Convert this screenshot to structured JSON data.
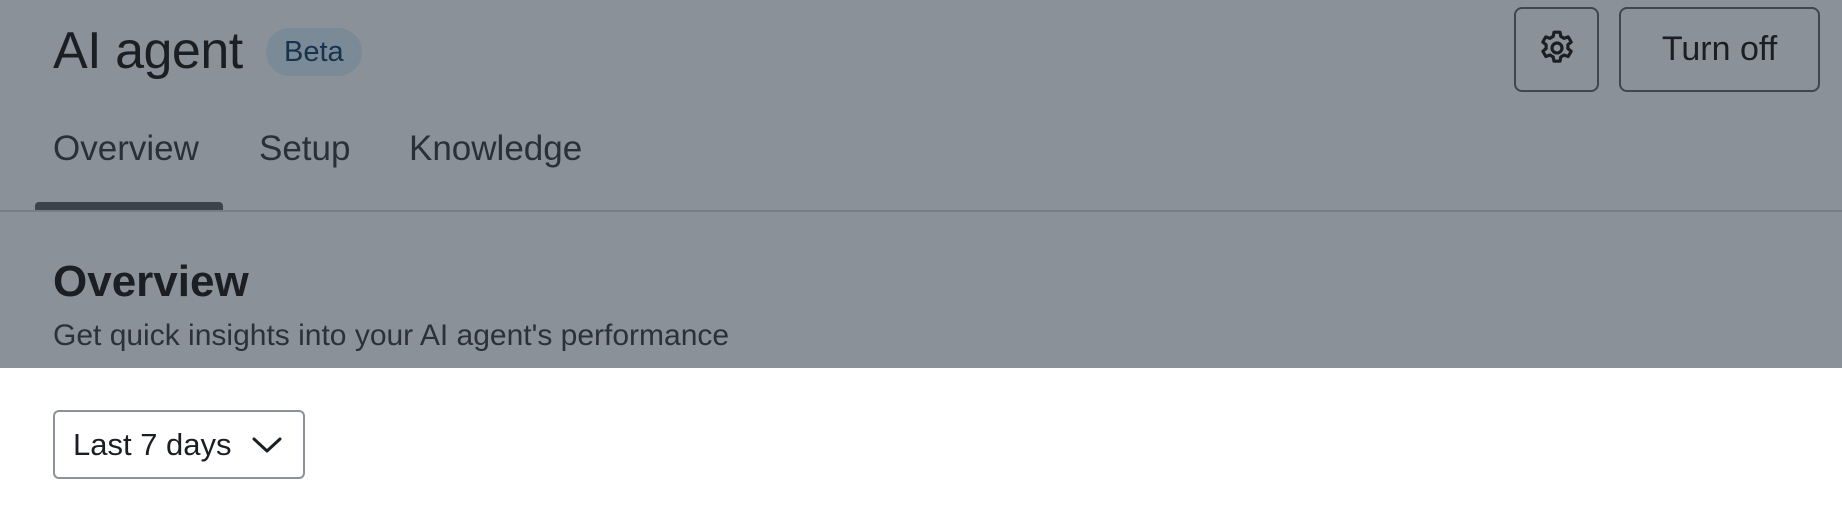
{
  "header": {
    "title": "AI agent",
    "badge": "Beta",
    "settings_icon": "gear-icon",
    "turn_off_label": "Turn off"
  },
  "tabs": [
    {
      "label": "Overview",
      "selected": true
    },
    {
      "label": "Setup",
      "selected": false
    },
    {
      "label": "Knowledge",
      "selected": false
    }
  ],
  "section": {
    "title": "Overview",
    "subtitle": "Get quick insights into your AI agent's performance"
  },
  "date_range": {
    "selected": "Last 7 days",
    "icon": "chevron-down-icon"
  },
  "colors": {
    "header_overlay": "#8a9199",
    "text_primary": "#1b1f24",
    "badge_bg": "#7b8a97",
    "badge_text": "#16324d",
    "page_bg": "#ffffff"
  }
}
